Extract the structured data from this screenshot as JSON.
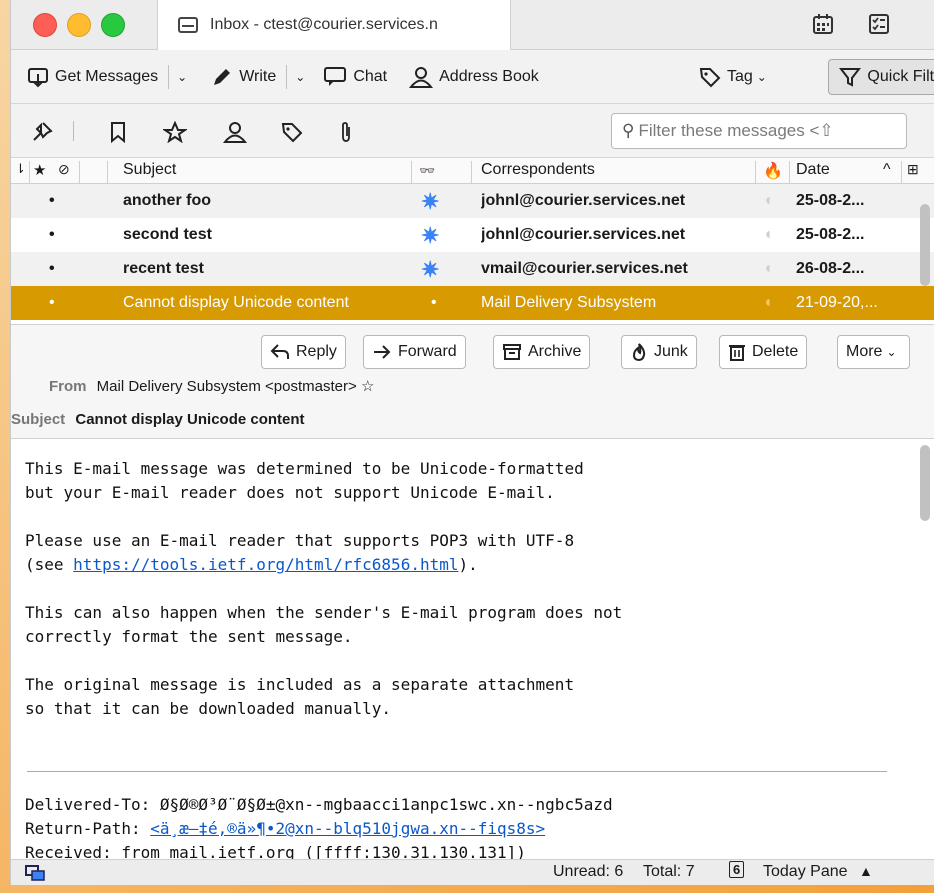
{
  "window": {
    "tab_title": "Inbox - ctest@courier.services.n"
  },
  "toolbar": {
    "get_messages": "Get Messages",
    "write": "Write",
    "chat": "Chat",
    "address_book": "Address Book",
    "tag": "Tag",
    "quick_filter": "Quick Filte"
  },
  "filter": {
    "placeholder": "Filter these messages <⇧"
  },
  "thread": {
    "columns": {
      "subject": "Subject",
      "correspondents": "Correspondents",
      "date": "Date",
      "sort_arrow": "^"
    },
    "rows": [
      {
        "dot": "•",
        "subject": "another foo",
        "correspondent": "johnl@courier.services.net",
        "date": "25-08-2..."
      },
      {
        "dot": "•",
        "subject": "second test",
        "correspondent": "johnl@courier.services.net",
        "date": "25-08-2..."
      },
      {
        "dot": "•",
        "subject": "recent test",
        "correspondent": "vmail@courier.services.net",
        "date": "26-08-2..."
      },
      {
        "dot": "•",
        "subject": "Cannot display Unicode content",
        "correspondent": "Mail Delivery Subsystem",
        "date": "21-09-20,...",
        "thread_dot": "•"
      }
    ]
  },
  "message": {
    "actions": {
      "reply": "Reply",
      "forward": "Forward",
      "archive": "Archive",
      "junk": "Junk",
      "delete": "Delete",
      "more": "More"
    },
    "from_label": "From",
    "from_value": "Mail Delivery Subsystem <postmaster>",
    "subject_label": "Subject",
    "subject_value": "Cannot display Unicode content",
    "body": {
      "p1_l1": "This E-mail message was determined to be Unicode-formatted",
      "p1_l2": "but your E-mail reader does not support Unicode E-mail.",
      "p2_l1": "Please use an E-mail reader that supports POP3 with UTF-8",
      "p2_l2_pre": "(see ",
      "p2_link": "https://tools.ietf.org/html/rfc6856.html",
      "p2_l2_post": ").",
      "p3_l1": "This can also happen when the sender's E-mail program does not",
      "p3_l2": "correctly format the sent message.",
      "p4_l1": "The original message is included as a separate attachment",
      "p4_l2": "so that it can be downloaded manually.",
      "delivered_to": "Delivered-To: Ø§Ø®Ø³Ø¨Ø§Ø±@xn--mgbaacci1anpc1swc.xn--ngbc5azd",
      "return_path_label": "Return-Path: ",
      "return_path_link": "<ä¸æ–‡é‚®ä»¶•2@xn--blq510jgwa.xn--fiqs8s>",
      "received_partial": "Received: from mail.ietf.org ([ffff:130.31.130.131])"
    }
  },
  "status": {
    "unread": "Unread: 6",
    "total": "Total: 7",
    "today_pane": "Today Pane",
    "calendar_day": "6"
  },
  "colors": {
    "selected_row": "#d79a00",
    "link": "#0a58ca",
    "unread_star": "#3b82f6"
  }
}
